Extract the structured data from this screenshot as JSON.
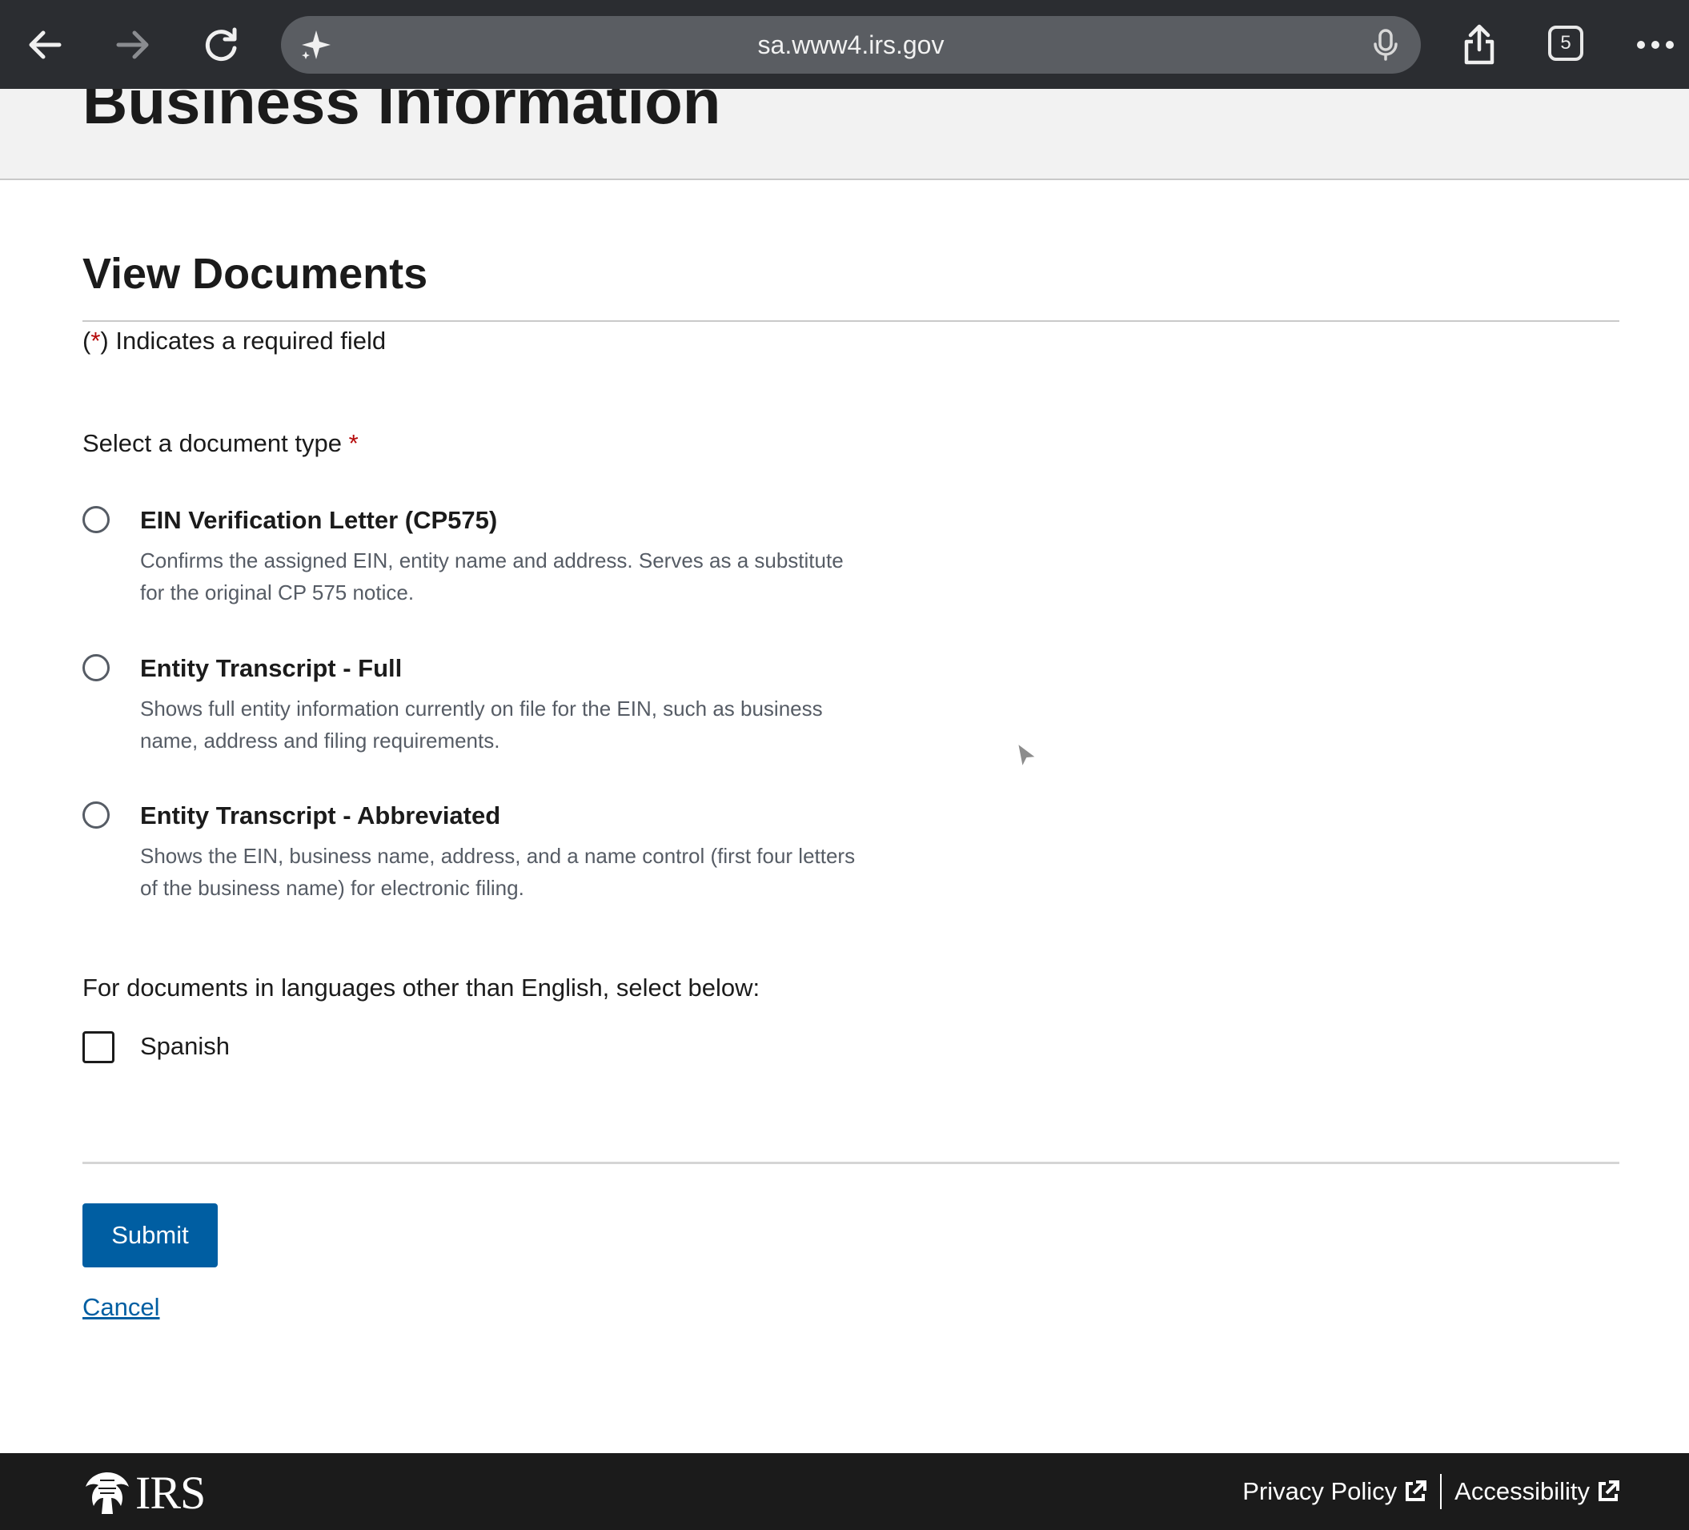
{
  "browser": {
    "url": "sa.www4.irs.gov",
    "tab_count": "5",
    "icons": [
      "back-arrow-icon",
      "forward-arrow-icon",
      "reload-icon",
      "sparkle-icon",
      "microphone-icon",
      "share-icon",
      "tabs-icon",
      "more-icon"
    ]
  },
  "header": {
    "title": "Business Information"
  },
  "form": {
    "section_title": "View Documents",
    "required_note": {
      "open": "(",
      "asterisk": "*",
      "close": ") Indicates a required field"
    },
    "document_type_label": "Select a document type",
    "required_asterisk": "*",
    "options": [
      {
        "title": "EIN Verification Letter (CP575)",
        "description": "Confirms the assigned EIN, entity name and address. Serves as a substitute for the original CP 575 notice.",
        "selected": false
      },
      {
        "title": "Entity Transcript - Full",
        "description": "Shows full entity information currently on file for the EIN, such as business name, address and filing requirements.",
        "selected": false
      },
      {
        "title": "Entity Transcript - Abbreviated",
        "description": "Shows the EIN, business name, address, and a name control (first four letters of the business name) for electronic filing.",
        "selected": false
      }
    ],
    "language_label": "For documents in languages other than English, select below:",
    "spanish_label": "Spanish",
    "spanish_checked": false,
    "submit_label": "Submit",
    "cancel_label": "Cancel"
  },
  "footer": {
    "logo_text": "IRS",
    "privacy_label": "Privacy Policy",
    "accessibility_label": "Accessibility"
  },
  "colors": {
    "chrome_bg": "#2b2d31",
    "primary": "#005ea2",
    "required": "#b50909",
    "footer_bg": "#1b1b1b"
  }
}
